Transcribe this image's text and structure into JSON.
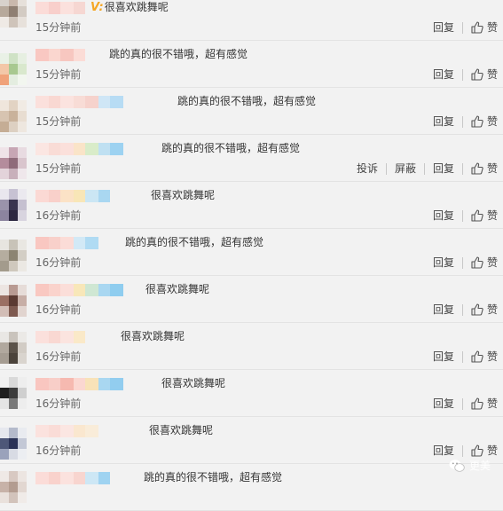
{
  "comments": [
    {
      "text_prefix": "V:",
      "text": "很喜欢跳舞呢",
      "time": "15分钟前",
      "actions": [
        "回复",
        "赞"
      ],
      "name_blocks": [
        "#fbdcd8",
        "#f8cfcb",
        "#fbe1dd",
        "#f6d7d2"
      ],
      "avatar": [
        "#d8d2cc",
        "#c9b8ac",
        "#e6e0da",
        "#b7a99b",
        "#8f7f72",
        "#d3cbc3",
        "#efeae5",
        "#cfc4ba",
        "#e7e1db"
      ]
    },
    {
      "text": "跳的真的很不错哦，超有感觉",
      "time": "15分钟前",
      "actions": [
        "回复",
        "赞"
      ],
      "name_blocks": [
        "#f9c8c2",
        "#fad6cf",
        "#f7c7c0",
        "#fbdcd6"
      ],
      "avatar": [
        "#e9f1e6",
        "#cfe2c5",
        "#e6efe1",
        "#f3c7a8",
        "#a8c890",
        "#d9e8cd",
        "#f0a27a",
        "#e4ede0",
        "#f2f6ef"
      ]
    },
    {
      "text": "跳的真的很不错哦，超有感觉",
      "time": "15分钟前",
      "actions": [
        "回复",
        "赞"
      ],
      "name_blocks": [
        "#fbe0dc",
        "#f9d8d2",
        "#fbe3df",
        "#f8dcd6",
        "#f6d2cc",
        "#cfe6f6",
        "#b7dcf4"
      ],
      "avatar": [
        "#efe6dc",
        "#e2d3c3",
        "#f1ebe4",
        "#d7c4b1",
        "#c9b29b",
        "#e8ddd1",
        "#c5ad95",
        "#ddd0c2",
        "#eee7df"
      ]
    },
    {
      "text": "跳的真的很不错哦，超有感觉",
      "time": "15分钟前",
      "actions": [
        "投诉",
        "屏蔽",
        "回复",
        "赞"
      ],
      "name_blocks": [
        "#fbe6e2",
        "#f9dcd6",
        "#fbe0db",
        "#fae4c8",
        "#d9ecc9",
        "#bfe0f2",
        "#9dd2f1"
      ],
      "avatar": [
        "#efe3e8",
        "#c7a6b4",
        "#e8dbe1",
        "#b48c9c",
        "#8f6b7a",
        "#d9c5cd",
        "#e3d3da",
        "#c8b0bb",
        "#efe7eb"
      ]
    },
    {
      "text": "很喜欢跳舞呢",
      "time": "16分钟前",
      "actions": [
        "回复",
        "赞"
      ],
      "name_blocks": [
        "#fbd9d4",
        "#f9d0ca",
        "#fbe2c6",
        "#f8e6b7",
        "#cbe6f4",
        "#a9d7f1"
      ],
      "avatar": [
        "#e9e7ee",
        "#c7c2d3",
        "#ebe9ef",
        "#9a93ab",
        "#3a3450",
        "#c5c0d0",
        "#8c849f",
        "#2e2842",
        "#d8d4df"
      ]
    },
    {
      "text": "跳的真的很不错哦，超有感觉",
      "time": "16分钟前",
      "actions": [
        "回复",
        "赞"
      ],
      "name_blocks": [
        "#f9c7c1",
        "#f8d0ca",
        "#fbdcd7",
        "#d2e9f6",
        "#b0dbf3"
      ],
      "avatar": [
        "#e7e5e0",
        "#c8c3b8",
        "#e9e7e2",
        "#b5ad9f",
        "#8c8472",
        "#d3cec5",
        "#a39b8c",
        "#cfc8bd",
        "#ebe8e3"
      ]
    },
    {
      "text": "很喜欢跳舞呢",
      "time": "16分钟前",
      "actions": [
        "回复",
        "赞"
      ],
      "name_blocks": [
        "#f9c8c1",
        "#fad3cc",
        "#fbded9",
        "#f8e7b9",
        "#cfe7d3",
        "#a9d7f1",
        "#8fcdef"
      ],
      "avatar": [
        "#ece5e2",
        "#b89a92",
        "#e6dcd8",
        "#9a6f63",
        "#5b3a32",
        "#c7aea6",
        "#d2bdb6",
        "#7e5a50",
        "#e1d4cf"
      ]
    },
    {
      "text": "很喜欢跳舞呢",
      "time": "16分钟前",
      "actions": [
        "回复",
        "赞"
      ],
      "name_blocks": [
        "#fbe0dc",
        "#f9d8d2",
        "#fbe4df",
        "#fae9c8"
      ],
      "avatar": [
        "#e9e7e4",
        "#c9c3bc",
        "#ebe9e6",
        "#b1a89e",
        "#5c534a",
        "#d2ccc5",
        "#a59c92",
        "#4b433b",
        "#d9d4ce"
      ]
    },
    {
      "text": "很喜欢跳舞呢",
      "time": "16分钟前",
      "actions": [
        "回复",
        "赞"
      ],
      "name_blocks": [
        "#f9c6c0",
        "#f8cec8",
        "#f6b9b0",
        "#fbd7d1",
        "#f8e2b8",
        "#a9d7f1",
        "#92cdef"
      ],
      "avatar": [
        "#f1f1f1",
        "#d9d9d9",
        "#eeeeee",
        "#1e1e1e",
        "#3c3c3c",
        "#cfcfcf",
        "#e5e5e5",
        "#7a7a7a",
        "#ededed"
      ]
    },
    {
      "text": "很喜欢跳舞呢",
      "time": "16分钟前",
      "actions": [
        "回复",
        "赞"
      ],
      "name_blocks": [
        "#fbe2de",
        "#fadcd7",
        "#fbe6e2",
        "#fae7cf",
        "#f9ecd9"
      ],
      "avatar": [
        "#e6e8ee",
        "#b4bacb",
        "#e9ebf0",
        "#4d5778",
        "#2a3256",
        "#c3c8d6",
        "#9aa2bb",
        "#d8dbe4",
        "#eceef2"
      ]
    },
    {
      "text": "跳的真的很不错哦，超有感觉",
      "time": "",
      "actions": [],
      "name_blocks": [
        "#fbdcd8",
        "#f9d2cc",
        "#fbe2de",
        "#f8d5cf",
        "#cde7f5",
        "#9fd3f1"
      ],
      "avatar": [
        "#efe9e6",
        "#d8c9c2",
        "#ece5e1",
        "#c7b2a8",
        "#b39c90",
        "#e2d7d1",
        "#e9e1dc",
        "#d2c3bb",
        "#f0ebe8"
      ]
    }
  ],
  "watermark": {
    "label": "更美"
  },
  "colors": {
    "background": "#f2f2f2",
    "divider": "#e3e3e3",
    "badge": "#f5a623"
  }
}
